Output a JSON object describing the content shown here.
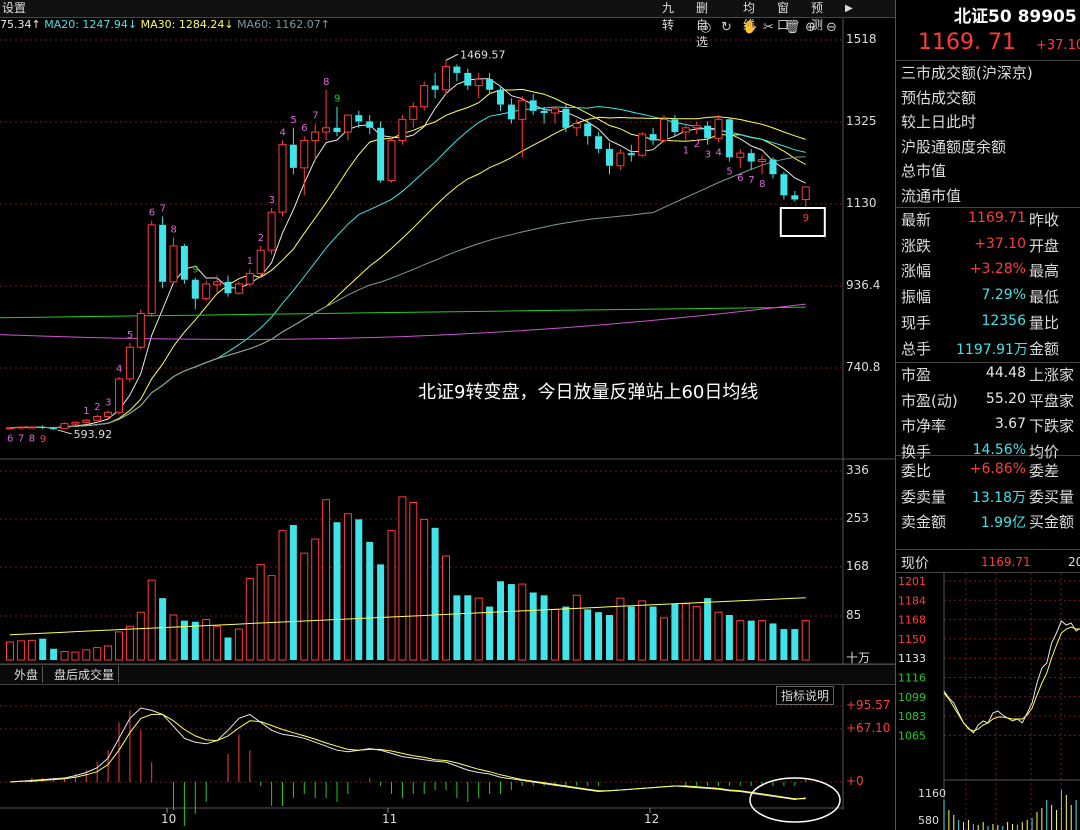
{
  "toolbar": {
    "settings": "设置",
    "ma_values": [
      {
        "text": "75.34↑",
        "color": "#e8e8e8"
      },
      {
        "text": "MA20: 1247.94↓",
        "color": "#3fe3e8"
      },
      {
        "text": "MA30: 1284.24↓",
        "color": "#ffff55"
      },
      {
        "text": "MA60: 1162.07↑",
        "color": "#7a9a9a"
      }
    ],
    "buttons": [
      "九转",
      "删自选",
      "均线",
      "窗口",
      "预测"
    ],
    "icons": [
      "eye-icon",
      "refresh-icon",
      "hand-icon",
      "scissors-icon",
      "trash-icon",
      "zoom-in-icon",
      "zoom-out-icon",
      "collapse-icon"
    ]
  },
  "annotation": "北证9转变盘，今日放量反弹站上60日均线",
  "price_axis": [
    "1518",
    "1325",
    "1130",
    "936.4",
    "740.8"
  ],
  "volume_axis": [
    "336",
    "253",
    "168",
    "85",
    "十万"
  ],
  "indicator_axis": [
    "+95.57",
    "+67.10",
    "+0"
  ],
  "price_high_label": "1469.57",
  "price_low_label": "593.92",
  "tabs": [
    "外盘",
    "盘后成交量"
  ],
  "indicator_button": "指标说明",
  "x_labels": [
    "10",
    "11",
    "12"
  ],
  "panel": {
    "title": "北证50 89905",
    "price": "1169. 71",
    "change": "+37.10",
    "info_list": [
      "三市成交额(沪深京)",
      "预估成交额",
      "较上日此时",
      "沪股通额度余额",
      "总市值",
      "流通市值"
    ],
    "quote_rows": [
      {
        "label": "最新",
        "value": "1169.71",
        "color": "#ff3b3b",
        "label2": "昨收"
      },
      {
        "label": "涨跌",
        "value": "+37.10",
        "color": "#ff3b3b",
        "label2": "开盘"
      },
      {
        "label": "涨幅",
        "value": "+3.28%",
        "color": "#ff3b3b",
        "label2": "最高"
      },
      {
        "label": "振幅",
        "value": "7.29%",
        "color": "#3fe3e8",
        "label2": "最低"
      },
      {
        "label": "现手",
        "value": "12356",
        "color": "#3fe3e8",
        "label2": "量比"
      },
      {
        "label": "总手",
        "value": "1197.91万",
        "color": "#3fe3e8",
        "label2": "金额"
      }
    ],
    "stats_rows": [
      {
        "label": "市盈",
        "value": "44.48",
        "color": "#e8e8e8",
        "label2": "上涨家"
      },
      {
        "label": "市盈(动)",
        "value": "55.20",
        "color": "#e8e8e8",
        "label2": "平盘家"
      },
      {
        "label": "市净率",
        "value": "3.67",
        "color": "#e8e8e8",
        "label2": "下跌家"
      },
      {
        "label": "换手",
        "value": "14.56%",
        "color": "#3fe3e8",
        "label2": "均价"
      }
    ],
    "order_rows": [
      {
        "label": "委比",
        "value": "+6.86%",
        "color": "#ff3b3b",
        "label2": "委差"
      },
      {
        "label": "委卖量",
        "value": "13.18万",
        "color": "#3fe3e8",
        "label2": "委买量"
      },
      {
        "label": "卖金额",
        "value": "1.99亿",
        "color": "#3fe3e8",
        "label2": "买金额"
      }
    ],
    "mini": {
      "label": "现价",
      "price": "1169.71",
      "extra": "20",
      "axis": [
        "1201",
        "1184",
        "1168",
        "1150",
        "1133",
        "1116",
        "1099",
        "1083",
        "1065"
      ],
      "vol_axis": [
        "1160",
        "580"
      ]
    }
  },
  "chart_data": {
    "type": "candlestick",
    "candles": [
      [
        598,
        600,
        597,
        599
      ],
      [
        599,
        602,
        597,
        601
      ],
      [
        600,
        603,
        598,
        601
      ],
      [
        601,
        605,
        596,
        599
      ],
      [
        598,
        600,
        594,
        597
      ],
      [
        597,
        612,
        596,
        609
      ],
      [
        608,
        614,
        605,
        612
      ],
      [
        612,
        620,
        610,
        617
      ],
      [
        617,
        630,
        615,
        626
      ],
      [
        626,
        640,
        622,
        636
      ],
      [
        636,
        720,
        630,
        715
      ],
      [
        715,
        800,
        708,
        790
      ],
      [
        790,
        880,
        785,
        870
      ],
      [
        870,
        1090,
        862,
        1080
      ],
      [
        1080,
        1100,
        930,
        945
      ],
      [
        945,
        1050,
        938,
        1030
      ],
      [
        1030,
        1035,
        940,
        950
      ],
      [
        950,
        955,
        880,
        905
      ],
      [
        905,
        948,
        900,
        940
      ],
      [
        938,
        960,
        920,
        945
      ],
      [
        945,
        960,
        910,
        918
      ],
      [
        918,
        945,
        915,
        940
      ],
      [
        940,
        975,
        935,
        965
      ],
      [
        965,
        1030,
        955,
        1020
      ],
      [
        1020,
        1120,
        1010,
        1110
      ],
      [
        1110,
        1280,
        1100,
        1270
      ],
      [
        1270,
        1310,
        1200,
        1215
      ],
      [
        1215,
        1290,
        1150,
        1280
      ],
      [
        1280,
        1320,
        1230,
        1300
      ],
      [
        1300,
        1400,
        1280,
        1310
      ],
      [
        1310,
        1360,
        1290,
        1300
      ],
      [
        1300,
        1340,
        1280,
        1340
      ],
      [
        1340,
        1350,
        1310,
        1325
      ],
      [
        1325,
        1340,
        1295,
        1310
      ],
      [
        1310,
        1325,
        1180,
        1185
      ],
      [
        1185,
        1290,
        1180,
        1280
      ],
      [
        1280,
        1340,
        1270,
        1330
      ],
      [
        1330,
        1370,
        1310,
        1360
      ],
      [
        1360,
        1420,
        1350,
        1410
      ],
      [
        1410,
        1440,
        1380,
        1400
      ],
      [
        1400,
        1470,
        1390,
        1455
      ],
      [
        1455,
        1460,
        1420,
        1440
      ],
      [
        1440,
        1450,
        1400,
        1410
      ],
      [
        1410,
        1440,
        1380,
        1425
      ],
      [
        1425,
        1440,
        1390,
        1400
      ],
      [
        1400,
        1410,
        1350,
        1365
      ],
      [
        1365,
        1380,
        1320,
        1330
      ],
      [
        1330,
        1385,
        1240,
        1375
      ],
      [
        1375,
        1390,
        1340,
        1350
      ],
      [
        1350,
        1360,
        1320,
        1345
      ],
      [
        1345,
        1360,
        1320,
        1355
      ],
      [
        1355,
        1365,
        1300,
        1310
      ],
      [
        1310,
        1330,
        1290,
        1320
      ],
      [
        1320,
        1330,
        1270,
        1290
      ],
      [
        1290,
        1300,
        1250,
        1260
      ],
      [
        1260,
        1275,
        1200,
        1220
      ],
      [
        1220,
        1260,
        1210,
        1250
      ],
      [
        1250,
        1270,
        1230,
        1245
      ],
      [
        1245,
        1300,
        1240,
        1295
      ],
      [
        1295,
        1310,
        1270,
        1280
      ],
      [
        1280,
        1340,
        1275,
        1330
      ],
      [
        1330,
        1340,
        1290,
        1300
      ],
      [
        1300,
        1320,
        1280,
        1310
      ],
      [
        1310,
        1325,
        1295,
        1315
      ],
      [
        1315,
        1325,
        1270,
        1285
      ],
      [
        1285,
        1340,
        1275,
        1330
      ],
      [
        1330,
        1335,
        1230,
        1240
      ],
      [
        1240,
        1260,
        1215,
        1250
      ],
      [
        1250,
        1260,
        1210,
        1230
      ],
      [
        1230,
        1245,
        1200,
        1235
      ],
      [
        1235,
        1240,
        1190,
        1200
      ],
      [
        1200,
        1205,
        1140,
        1150
      ],
      [
        1150,
        1160,
        1135,
        1140
      ],
      [
        1140,
        1170,
        1120,
        1169.71
      ]
    ],
    "ma": [
      {
        "name": "MA5",
        "color": "#e8e8e8"
      },
      {
        "name": "MA10",
        "color": "#ffff55"
      },
      {
        "name": "MA20",
        "color": "#3fe3e8"
      },
      {
        "name": "MA30",
        "color": "#ffff55"
      },
      {
        "name": "MA60",
        "color": "#7a9a9a"
      }
    ],
    "long_lines": [
      {
        "color": "#22cc22",
        "from": 860,
        "to": 885
      },
      {
        "color": "#cc55cc",
        "from": 820,
        "to": 900
      }
    ],
    "td_labels": [
      {
        "i": 0,
        "t": "6",
        "above": false,
        "color": "#dd66dd"
      },
      {
        "i": 1,
        "t": "7",
        "above": false,
        "color": "#dd66dd"
      },
      {
        "i": 2,
        "t": "8",
        "above": false,
        "color": "#dd66dd"
      },
      {
        "i": 3,
        "t": "9",
        "above": false,
        "color": "#ff3b3b"
      },
      {
        "i": 7,
        "t": "1",
        "above": true,
        "color": "#dd66dd"
      },
      {
        "i": 8,
        "t": "2",
        "above": true,
        "color": "#dd66dd"
      },
      {
        "i": 9,
        "t": "3",
        "above": true,
        "color": "#dd66dd"
      },
      {
        "i": 10,
        "t": "4",
        "above": true,
        "color": "#dd66dd"
      },
      {
        "i": 11,
        "t": "5",
        "above": true,
        "color": "#dd66dd"
      },
      {
        "i": 13,
        "t": "6",
        "above": true,
        "color": "#dd66dd"
      },
      {
        "i": 14,
        "t": "7",
        "above": true,
        "color": "#dd66dd"
      },
      {
        "i": 15,
        "t": "8",
        "above": true,
        "color": "#dd66dd"
      },
      {
        "i": 17,
        "t": "9",
        "above": true,
        "color": "#22cc22"
      },
      {
        "i": 22,
        "t": "1",
        "above": true,
        "color": "#dd66dd"
      },
      {
        "i": 23,
        "t": "2",
        "above": true,
        "color": "#dd66dd"
      },
      {
        "i": 24,
        "t": "3",
        "above": true,
        "color": "#dd66dd"
      },
      {
        "i": 25,
        "t": "4",
        "above": true,
        "color": "#dd66dd"
      },
      {
        "i": 26,
        "t": "5",
        "above": true,
        "color": "#dd66dd"
      },
      {
        "i": 27,
        "t": "6",
        "above": true,
        "color": "#dd66dd"
      },
      {
        "i": 28,
        "t": "7",
        "above": true,
        "color": "#dd66dd"
      },
      {
        "i": 29,
        "t": "8",
        "above": true,
        "color": "#dd66dd"
      },
      {
        "i": 30,
        "t": "9",
        "above": true,
        "color": "#22cc22"
      },
      {
        "i": 62,
        "t": "1",
        "above": false,
        "color": "#dd66dd"
      },
      {
        "i": 63,
        "t": "2",
        "above": false,
        "color": "#dd66dd"
      },
      {
        "i": 64,
        "t": "3",
        "above": false,
        "color": "#dd66dd"
      },
      {
        "i": 65,
        "t": "4",
        "above": false,
        "color": "#dd66dd"
      },
      {
        "i": 66,
        "t": "5",
        "above": false,
        "color": "#dd66dd"
      },
      {
        "i": 67,
        "t": "6",
        "above": false,
        "color": "#dd66dd"
      },
      {
        "i": 68,
        "t": "7",
        "above": false,
        "color": "#dd66dd"
      },
      {
        "i": 69,
        "t": "8",
        "above": false,
        "color": "#dd66dd"
      },
      {
        "i": 73,
        "t": "9",
        "above": false,
        "color": "#ff3b3b"
      }
    ],
    "volume": [
      32,
      34,
      35,
      38,
      20,
      15,
      14,
      18,
      22,
      25,
      50,
      60,
      85,
      142,
      110,
      80,
      70,
      68,
      72,
      60,
      40,
      55,
      145,
      170,
      150,
      230,
      240,
      190,
      215,
      285,
      245,
      260,
      250,
      210,
      170,
      230,
      290,
      280,
      250,
      235,
      185,
      115,
      115,
      110,
      95,
      140,
      135,
      135,
      120,
      115,
      90,
      95,
      115,
      90,
      85,
      80,
      110,
      95,
      105,
      95,
      75,
      100,
      100,
      95,
      110,
      85,
      80,
      70,
      70,
      70,
      65,
      55,
      55,
      70
    ],
    "macd": {
      "dif": [
        0,
        1,
        2,
        3,
        4,
        5,
        8,
        12,
        18,
        30,
        55,
        80,
        93,
        90,
        85,
        70,
        55,
        50,
        48,
        52,
        65,
        80,
        85,
        75,
        65,
        60,
        58,
        55,
        50,
        45,
        40,
        38,
        40,
        42,
        40,
        36,
        32,
        30,
        28,
        26,
        25,
        20,
        15,
        12,
        10,
        6,
        4,
        2,
        0,
        -2,
        -4,
        -6,
        -8,
        -10,
        -12,
        -11,
        -10,
        -9,
        -8,
        -7,
        -6,
        -5,
        -6,
        -7,
        -8,
        -9,
        -11,
        -12,
        -14,
        -16,
        -18,
        -20,
        -22,
        -20
      ],
      "dea": [
        0,
        1,
        1,
        2,
        3,
        4,
        6,
        9,
        13,
        22,
        40,
        62,
        80,
        85,
        85,
        77,
        66,
        58,
        53,
        52,
        58,
        68,
        77,
        76,
        71,
        66,
        62,
        58,
        54,
        49,
        45,
        41,
        40,
        41,
        41,
        39,
        36,
        33,
        31,
        28,
        27,
        24,
        20,
        16,
        13,
        9,
        6,
        3,
        1,
        -1,
        -3,
        -5,
        -7,
        -9,
        -11,
        -11,
        -10,
        -9,
        -8,
        -7,
        -6,
        -5,
        -5,
        -6,
        -7,
        -8,
        -10,
        -11,
        -13,
        -15,
        -17,
        -19,
        -21,
        -21
      ]
    }
  }
}
